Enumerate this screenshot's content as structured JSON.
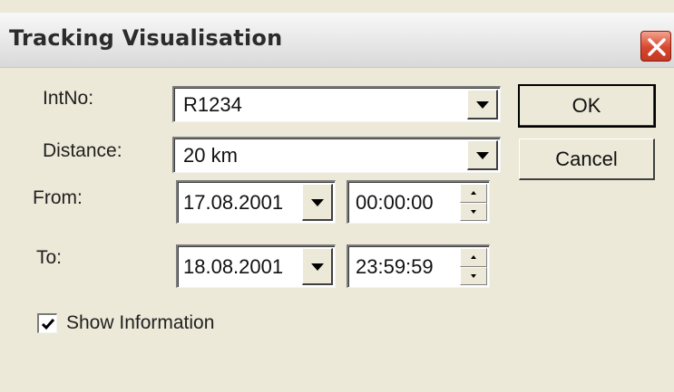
{
  "window": {
    "title": "Tracking Visualisation",
    "close_icon": "close-icon"
  },
  "form": {
    "intno": {
      "label": "IntNo:",
      "value": "R1234"
    },
    "distance": {
      "label": "Distance:",
      "value": "20 km"
    },
    "from": {
      "label": "From:",
      "date": "17.08.2001",
      "time": "00:00:00"
    },
    "to": {
      "label": "To:",
      "date": "18.08.2001",
      "time": "23:59:59"
    },
    "show_information": {
      "label": "Show Information",
      "checked": true
    }
  },
  "buttons": {
    "ok": "OK",
    "cancel": "Cancel"
  },
  "colors": {
    "dialog_bg": "#ece9d8",
    "close_red": "#d8462e"
  }
}
